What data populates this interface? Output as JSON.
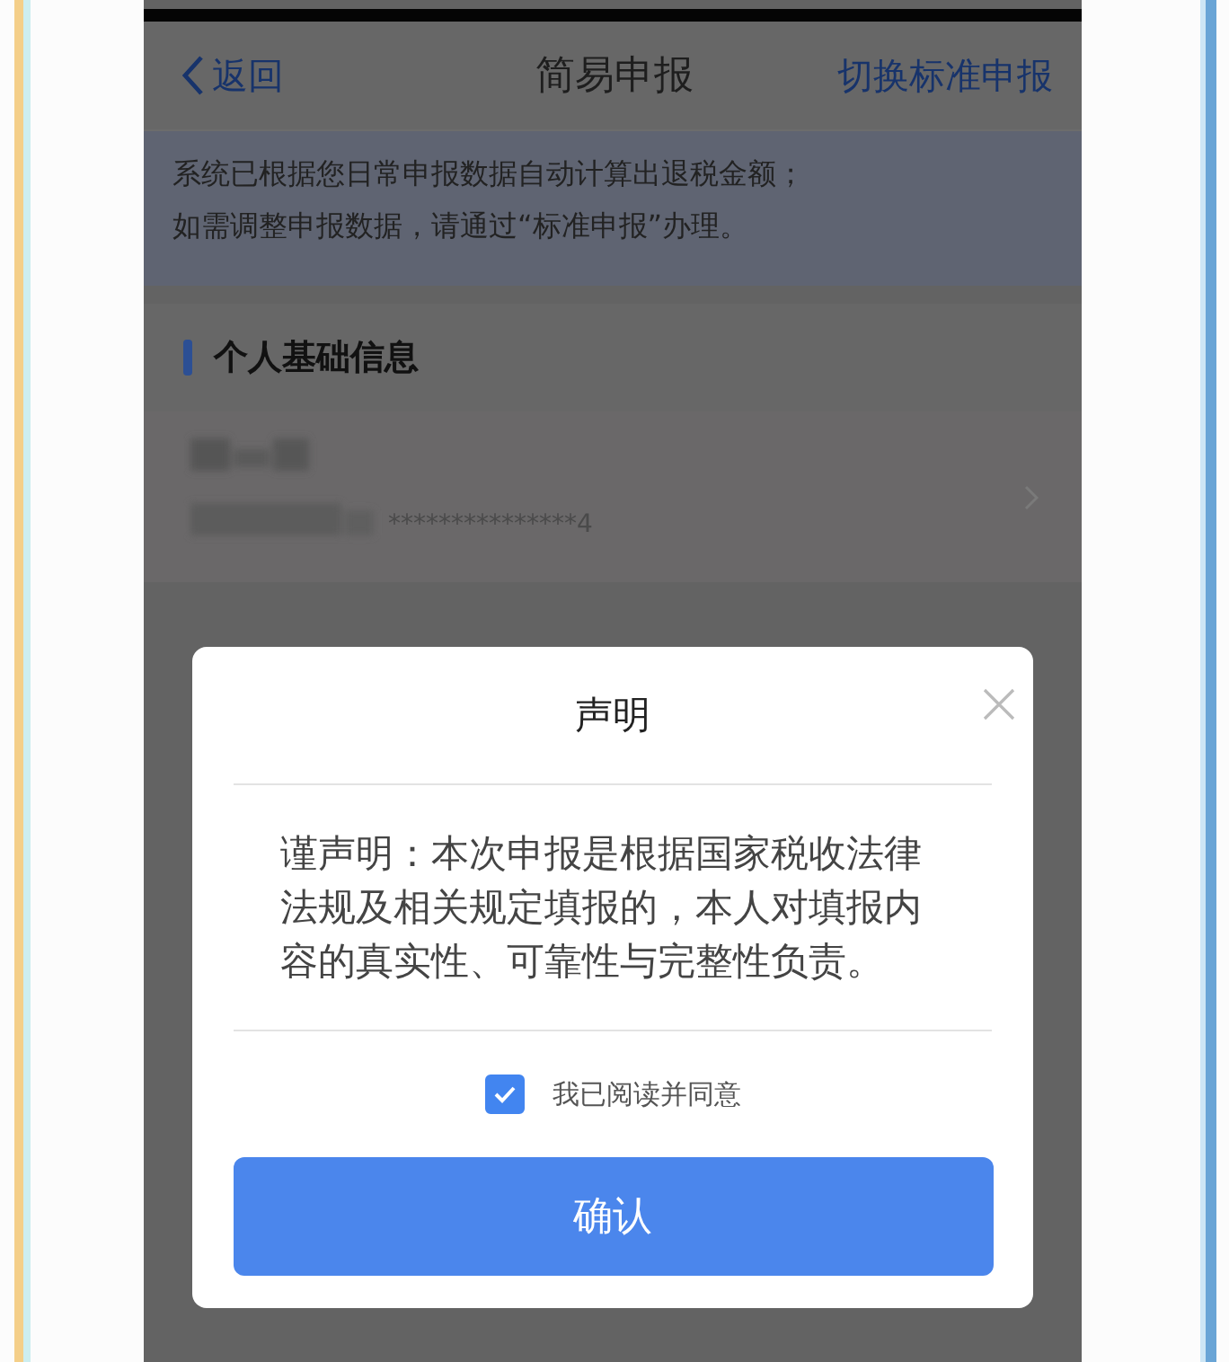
{
  "nav": {
    "back": "返回",
    "title": "简易申报",
    "action": "切换标准申报"
  },
  "notice": [
    "系统已根据您日常申报数据自动计算出退税金额；",
    "如需调整申报数据，请通过“标准申报”办理。"
  ],
  "section": {
    "title": "个人基础信息"
  },
  "person": {
    "id_masked": "***************4"
  },
  "dialog": {
    "title": "声明",
    "body": "谨声明：本次申报是根据国家税收法律法规及相关规定填报的，本人对填报内容的真实性、可靠性与完整性负责。",
    "agreement": {
      "label": "我已阅读并同意",
      "checked": true
    },
    "confirm": "确认"
  }
}
